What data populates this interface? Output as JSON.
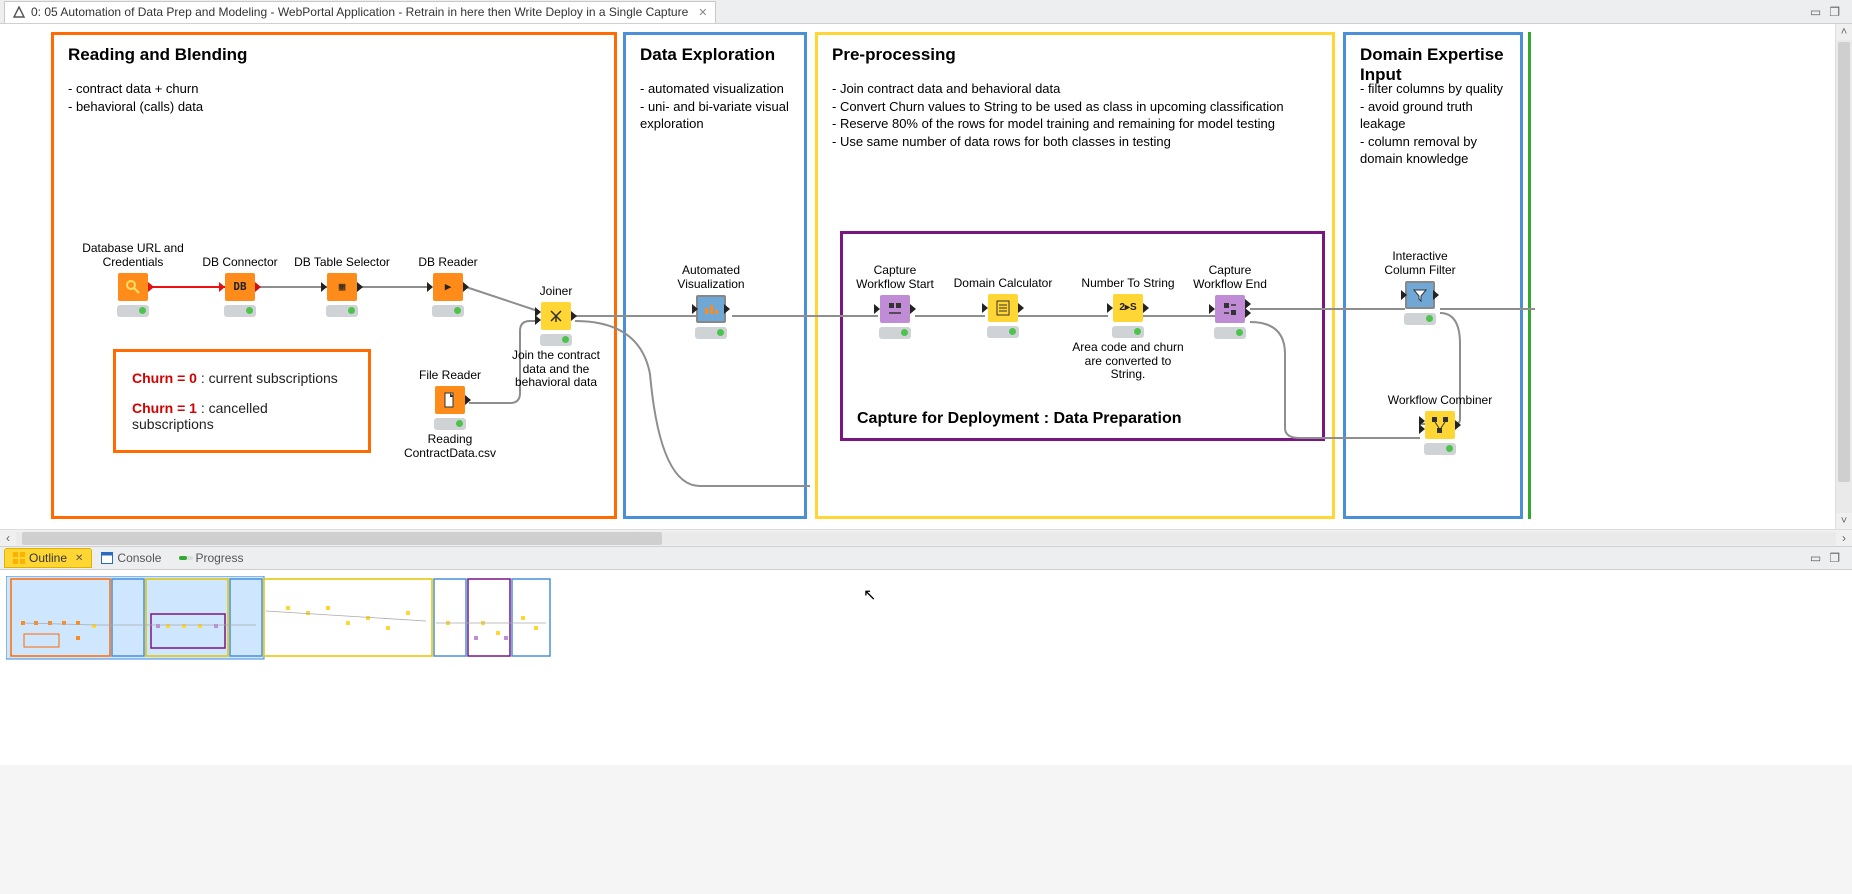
{
  "tab": {
    "title": "0: 05 Automation of Data Prep and Modeling - WebPortal Application - Retrain in here then Write Deploy in a Single Capture"
  },
  "regions": {
    "reading": {
      "title": "Reading and Blending",
      "bullets": "- contract data + churn\n- behavioral (calls) data"
    },
    "explore": {
      "title": "Data Exploration",
      "bullets": "- automated visualization\n- uni- and bi-variate visual\n  exploration"
    },
    "preproc": {
      "title": "Pre-processing",
      "bullets": "- Join contract data and behavioral data\n- Convert Churn values to String to be used as class in upcoming classification\n- Reserve 80% of the rows for model training and remaining for model testing\n- Use same number of data rows for both classes in testing"
    },
    "domain": {
      "title": "Domain Expertise Input",
      "bullets": "- filter columns by quality\n- avoid ground truth leakage\n- column removal by\n  domain knowledge"
    },
    "capture": {
      "title": "Capture for Deployment : Data Preparation"
    }
  },
  "churn": {
    "zero_label": "Churn = 0",
    "zero_text": " : current subscriptions",
    "one_label": "Churn = 1",
    "one_text": " : cancelled subscriptions"
  },
  "nodes": {
    "db_url": {
      "label": "Database URL and\nCredentials"
    },
    "db_conn": {
      "label": "DB Connector"
    },
    "db_sel": {
      "label": "DB Table Selector"
    },
    "db_read": {
      "label": "DB Reader"
    },
    "joiner": {
      "label": "Joiner",
      "sub": "Join the contract\ndata and the\nbehavioral data"
    },
    "file": {
      "label": "File Reader",
      "sub": "Reading\nContractData.csv"
    },
    "autoviz": {
      "label": "Automated\nVisualization"
    },
    "cap_start": {
      "label": "Capture\nWorkflow Start"
    },
    "domcalc": {
      "label": "Domain Calculator"
    },
    "num2str": {
      "label": "Number To String",
      "sub": "Area code and churn\nare converted to String."
    },
    "cap_end": {
      "label": "Capture\nWorkflow End"
    },
    "colfilt": {
      "label": "Interactive\nColumn Filter"
    },
    "wfcomb": {
      "label": "Workflow Combiner"
    }
  },
  "views": {
    "outline": "Outline",
    "console": "Console",
    "progress": "Progress"
  }
}
